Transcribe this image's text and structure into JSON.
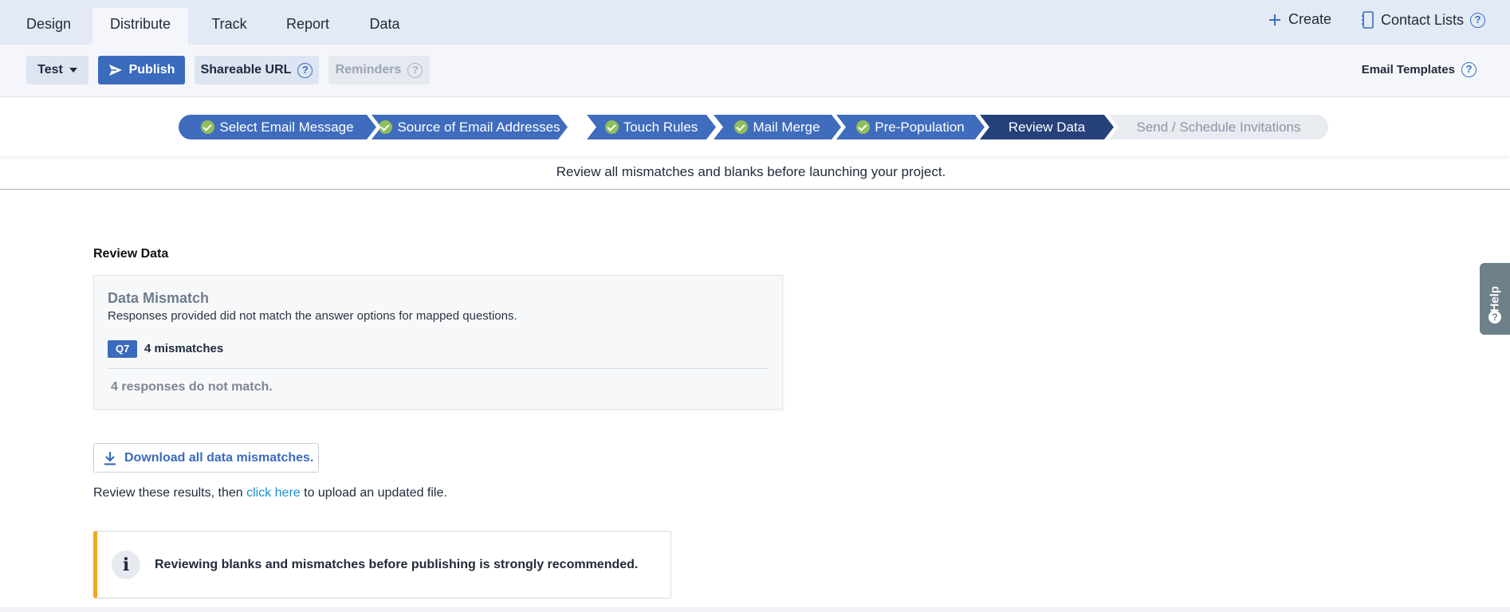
{
  "tabs": [
    {
      "label": "Design"
    },
    {
      "label": "Distribute"
    },
    {
      "label": "Track"
    },
    {
      "label": "Report"
    },
    {
      "label": "Data"
    }
  ],
  "active_tab": "Distribute",
  "top_actions": {
    "create_label": "Create",
    "contact_lists_label": "Contact Lists"
  },
  "toolbar": {
    "test_label": "Test",
    "publish_label": "Publish",
    "shareable_url_label": "Shareable URL",
    "reminders_label": "Reminders",
    "email_templates_label": "Email Templates"
  },
  "wizard": {
    "steps": [
      {
        "label": "Select Email Message",
        "state": "done"
      },
      {
        "label": "Source of Email Addresses",
        "state": "done"
      },
      {
        "label": "Touch Rules",
        "state": "done"
      },
      {
        "label": "Mail Merge",
        "state": "done"
      },
      {
        "label": "Pre-Population",
        "state": "done"
      },
      {
        "label": "Review Data",
        "state": "current"
      },
      {
        "label": "Send / Schedule Invitations",
        "state": "future"
      }
    ],
    "subtitle": "Review all mismatches and blanks before launching your project."
  },
  "main": {
    "section_title": "Review Data",
    "mismatch_card": {
      "title": "Data Mismatch",
      "description": "Responses provided did not match the answer options for mapped questions.",
      "question_badge": "Q7",
      "mismatch_count": "4 mismatches",
      "footer": "4 responses do not match."
    },
    "download_label": "Download all data mismatches.",
    "review_text_before": "Review these results, then ",
    "review_link": "click here",
    "review_text_after": " to upload an updated file.",
    "notice": {
      "icon": "i",
      "text": "Reviewing blanks and mismatches before publishing is strongly recommended."
    }
  },
  "help_tab": {
    "label": "Help",
    "icon": "?"
  },
  "colors": {
    "accent": "#3b6bbd",
    "step_current": "#25407a",
    "check_green": "#8fbf5a",
    "notice_border": "#f2a81d",
    "link": "#1a8fd1"
  }
}
